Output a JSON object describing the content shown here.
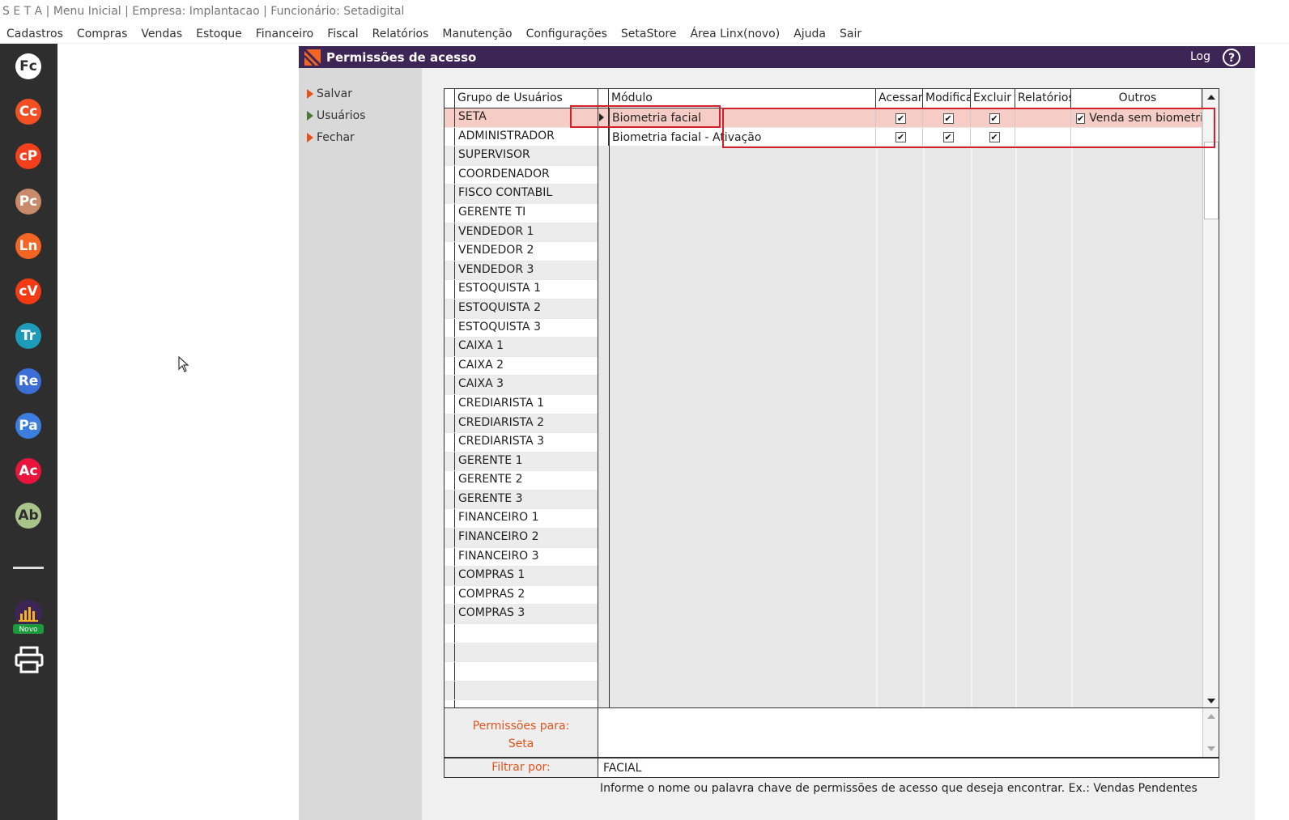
{
  "titlebar": {
    "text": "S E T A | Menu Inicial | Empresa: Implantacao | Funcionário: Setadigital"
  },
  "menu": [
    "Cadastros",
    "Compras",
    "Vendas",
    "Estoque",
    "Financeiro",
    "Fiscal",
    "Relatórios",
    "Manutenção",
    "Configurações",
    "SetaStore",
    "Área Linx(novo)",
    "Ajuda",
    "Sair"
  ],
  "sidebar": {
    "apps": [
      {
        "label": "Fc",
        "color": "#ffffff",
        "text_color": "#2e2e2e"
      },
      {
        "label": "Cc",
        "color": "#f25022",
        "text_color": "#ffffff"
      },
      {
        "label": "cP",
        "color": "#f23f1c",
        "text_color": "#ffffff"
      },
      {
        "label": "Pc",
        "color": "#c98a6a",
        "text_color": "#ffffff"
      },
      {
        "label": "Ln",
        "color": "#f26522",
        "text_color": "#ffffff"
      },
      {
        "label": "cV",
        "color": "#f23a14",
        "text_color": "#ffffff"
      },
      {
        "label": "Tr",
        "color": "#1e9bb8",
        "text_color": "#ffffff"
      },
      {
        "label": "Re",
        "color": "#3b6fd6",
        "text_color": "#ffffff"
      },
      {
        "label": "Pa",
        "color": "#3b7ee0",
        "text_color": "#ffffff"
      },
      {
        "label": "Ac",
        "color": "#e8143c",
        "text_color": "#ffffff"
      },
      {
        "label": "Ab",
        "color": "#a8c48a",
        "text_color": "#2e2e2e"
      }
    ],
    "novo_label": "Novo"
  },
  "window": {
    "title": "Permissões de acesso",
    "log_label": "Log",
    "header_color": "#3d2555"
  },
  "actions": [
    {
      "label": "Salvar",
      "arrow": "orange"
    },
    {
      "label": "Usuários",
      "arrow": "green"
    },
    {
      "label": "Fechar",
      "arrow": "orange"
    }
  ],
  "groups": {
    "header": "Grupo de Usuários",
    "rows": [
      "SETA",
      "ADMINISTRADOR",
      "SUPERVISOR",
      "COORDENADOR",
      "FISCO CONTABIL",
      "GERENTE TI",
      "VENDEDOR 1",
      "VENDEDOR 2",
      "VENDEDOR 3",
      "ESTOQUISTA 1",
      "ESTOQUISTA 2",
      "ESTOQUISTA 3",
      "CAIXA 1",
      "CAIXA 2",
      "CAIXA 3",
      "CREDIARISTA 1",
      "CREDIARISTA 2",
      "CREDIARISTA 3",
      "GERENTE 1",
      "GERENTE 2",
      "GERENTE 3",
      "FINANCEIRO 1",
      "FINANCEIRO 2",
      "FINANCEIRO 3",
      "COMPRAS 1",
      "COMPRAS 2",
      "COMPRAS 3"
    ],
    "selected": "SETA"
  },
  "modules": {
    "headers": {
      "modulo": "Módulo",
      "acessar": "Acessar",
      "modifica": "Modifica",
      "excluir": "Excluir",
      "relatorios": "Relatórios",
      "outros": "Outros"
    },
    "rows": [
      {
        "modulo": "Biometria facial",
        "acessar": true,
        "modifica": true,
        "excluir": true,
        "relatorios": "",
        "outros": "Venda sem biometria",
        "outros_checked": true
      },
      {
        "modulo": "Biometria facial - Ativação",
        "acessar": true,
        "modifica": true,
        "excluir": true,
        "relatorios": "",
        "outros": "",
        "outros_checked": false
      }
    ]
  },
  "permissions_for": {
    "label": "Permissões para:",
    "value": "Seta"
  },
  "filter": {
    "label": "Filtrar por:",
    "value": "FACIAL"
  },
  "hint": "Informe o nome ou palavra chave de permissões de acesso que deseja encontrar. Ex.: Vendas Pendentes",
  "accent_color": "#e2541c",
  "highlight_color": "#d3202a"
}
